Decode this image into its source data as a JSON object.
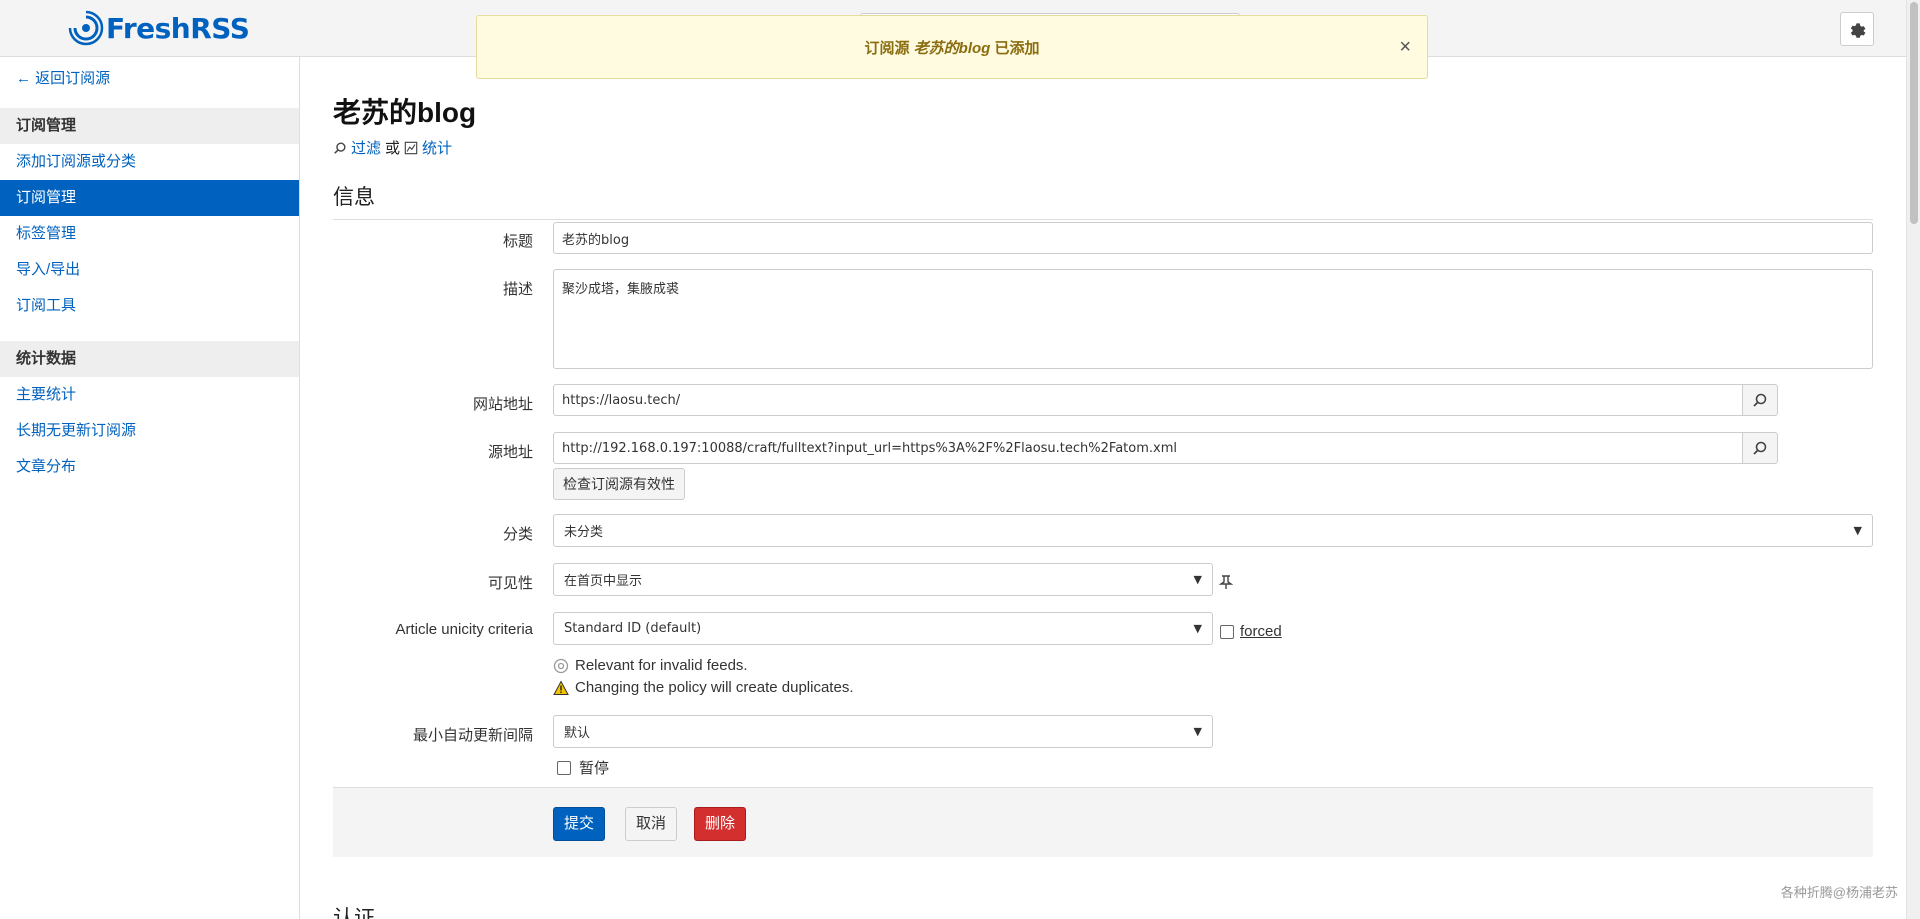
{
  "app": {
    "name": "FreshRSS",
    "accent": "#0062be"
  },
  "notification": {
    "prefix": "订阅源",
    "feed_name": "老苏的blog",
    "suffix": "已添加",
    "close": "×"
  },
  "sidebar": {
    "back": "← 返回订阅源",
    "group1_title": "订阅管理",
    "group1_items": [
      "添加订阅源或分类",
      "订阅管理",
      "标签管理",
      "导入/导出",
      "订阅工具"
    ],
    "group2_title": "统计数据",
    "group2_items": [
      "主要统计",
      "长期无更新订阅源",
      "文章分布"
    ]
  },
  "page": {
    "title": "老苏的blog",
    "link_filter": "过滤",
    "link_or": "或",
    "link_stats": "统计",
    "section_info": "信息",
    "section_next": "认证"
  },
  "form": {
    "title_label": "标题",
    "title_value": "老苏的blog",
    "desc_label": "描述",
    "desc_value": "聚沙成塔，集腋成裘",
    "site_label": "网站地址",
    "site_value": "https://laosu.tech/",
    "feed_label": "源地址",
    "feed_value": "http://192.168.0.197:10088/craft/fulltext?input_url=https%3A%2F%2Flaosu.tech%2Fatom.xml",
    "check_button": "检查订阅源有效性",
    "category_label": "分类",
    "category_value": "未分类",
    "visibility_label": "可见性",
    "visibility_value": "在首页中显示",
    "unicity_label": "Article unicity criteria",
    "unicity_value": "Standard ID (default)",
    "forced_label": "forced",
    "note_invalid": "Relevant for invalid feeds.",
    "note_duplicates": "Changing the policy will create duplicates.",
    "interval_label": "最小自动更新间隔",
    "interval_value": "默认",
    "pause_label": "暂停",
    "submit": "提交",
    "cancel": "取消",
    "delete": "删除"
  },
  "watermark": "各种折腾@杨浦老苏"
}
